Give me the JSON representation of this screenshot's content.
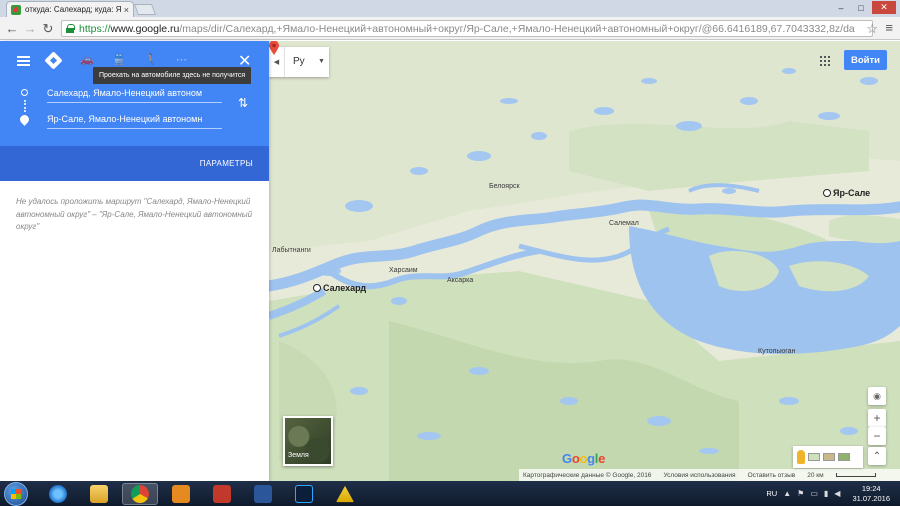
{
  "browser": {
    "tab_title": "откуда: Салехард; куда: Я",
    "tab_close": "×",
    "url_scheme": "https://",
    "url_host": "www.google.ru",
    "url_path": "/maps/dir/Салехард,+Ямало-Ненецкий+автономный+округ/Яр-Сале,+Ямало-Ненецкий+автономный+округ/@66.6416189,67.7043332,8z/da",
    "win_min": "–",
    "win_max": "□",
    "win_close": "✕",
    "back": "←",
    "forward": "→",
    "reload": "↻",
    "star": "☆",
    "menu": "≡"
  },
  "directions": {
    "tooltip": "Проехать на автомобиле здесь не получится",
    "origin": "Салехард, Ямало-Ненецкий автоном",
    "destination": "Яр-Сале, Ямало-Ненецкий автономн",
    "options_label": "ПАРАМЕТРЫ",
    "error_text": "Не удалось проложить маршрут \"Салехард, Ямало-Ненецкий автономный округ\" – \"Яр-Сале, Ямало-Ненецкий автономный округ\"",
    "close": "✕",
    "swap": "⇅",
    "modes": [
      "🚗",
      "🚆",
      "🚶",
      "⋯"
    ]
  },
  "map": {
    "language": "Ру",
    "sign_in": "Войти",
    "places": {
      "salekhard": "Салехард",
      "yar_sale": "Яр-Сале",
      "labytnangi": "Лабытнанги",
      "kharsaim": "Харсаим",
      "aksarka": "Аксарка",
      "beloyarsk": "Белоярск",
      "salemal": "Салемал",
      "kutopyugan": "Кутопьюган"
    },
    "earth_label": "Земля",
    "google_logo": [
      "G",
      "o",
      "o",
      "g",
      "l",
      "e"
    ],
    "colors": [
      "#4285f4",
      "#ea4335",
      "#fbbc05",
      "#4285f4",
      "#34a853",
      "#ea4335"
    ],
    "footer": {
      "data": "Картографические данные © Google, 2016",
      "terms": "Условия использования",
      "feedback": "Оставить отзыв",
      "scale": "20 км"
    },
    "zoom_in": "+",
    "zoom_out": "−",
    "locate": "◉",
    "expand": "⌃"
  },
  "taskbar": {
    "lang": "RU",
    "time": "19:24",
    "date": "31.07.2016"
  }
}
